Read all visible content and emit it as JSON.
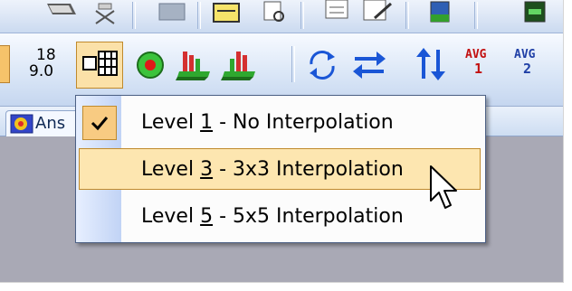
{
  "toolbar_top": {
    "icons": [
      "folder-open-icon",
      "tools-icon",
      "save-icon",
      "edit-icon",
      "find-icon",
      "notes-icon",
      "pen-icon",
      "color-bar-icon",
      "keypad-icon"
    ]
  },
  "toolbar_main": {
    "scale_top": "18",
    "scale_bottom": "9.0",
    "avg1_top": "AVG",
    "avg1_bottom": "1",
    "avg2_top": "AVG",
    "avg2_bottom": "2"
  },
  "tab": {
    "label": "Ans"
  },
  "menu": {
    "items": [
      {
        "prefix": "Level ",
        "key": "1",
        "suffix": " - No Interpolation",
        "checked": true,
        "highlighted": false
      },
      {
        "prefix": "Level ",
        "key": "3",
        "suffix": " - 3x3 Interpolation",
        "checked": false,
        "highlighted": true
      },
      {
        "prefix": "Level ",
        "key": "5",
        "suffix": " - 5x5 Interpolation",
        "checked": false,
        "highlighted": false
      }
    ]
  },
  "colors": {
    "menu_highlight": "#fde6b0",
    "menu_highlight_border": "#c08a2c",
    "checkbox_fill": "#f8cb82",
    "menu_gutter": "#c1d3f5",
    "arrow_blue": "#1a56d6",
    "avg_red": "#c21010"
  }
}
